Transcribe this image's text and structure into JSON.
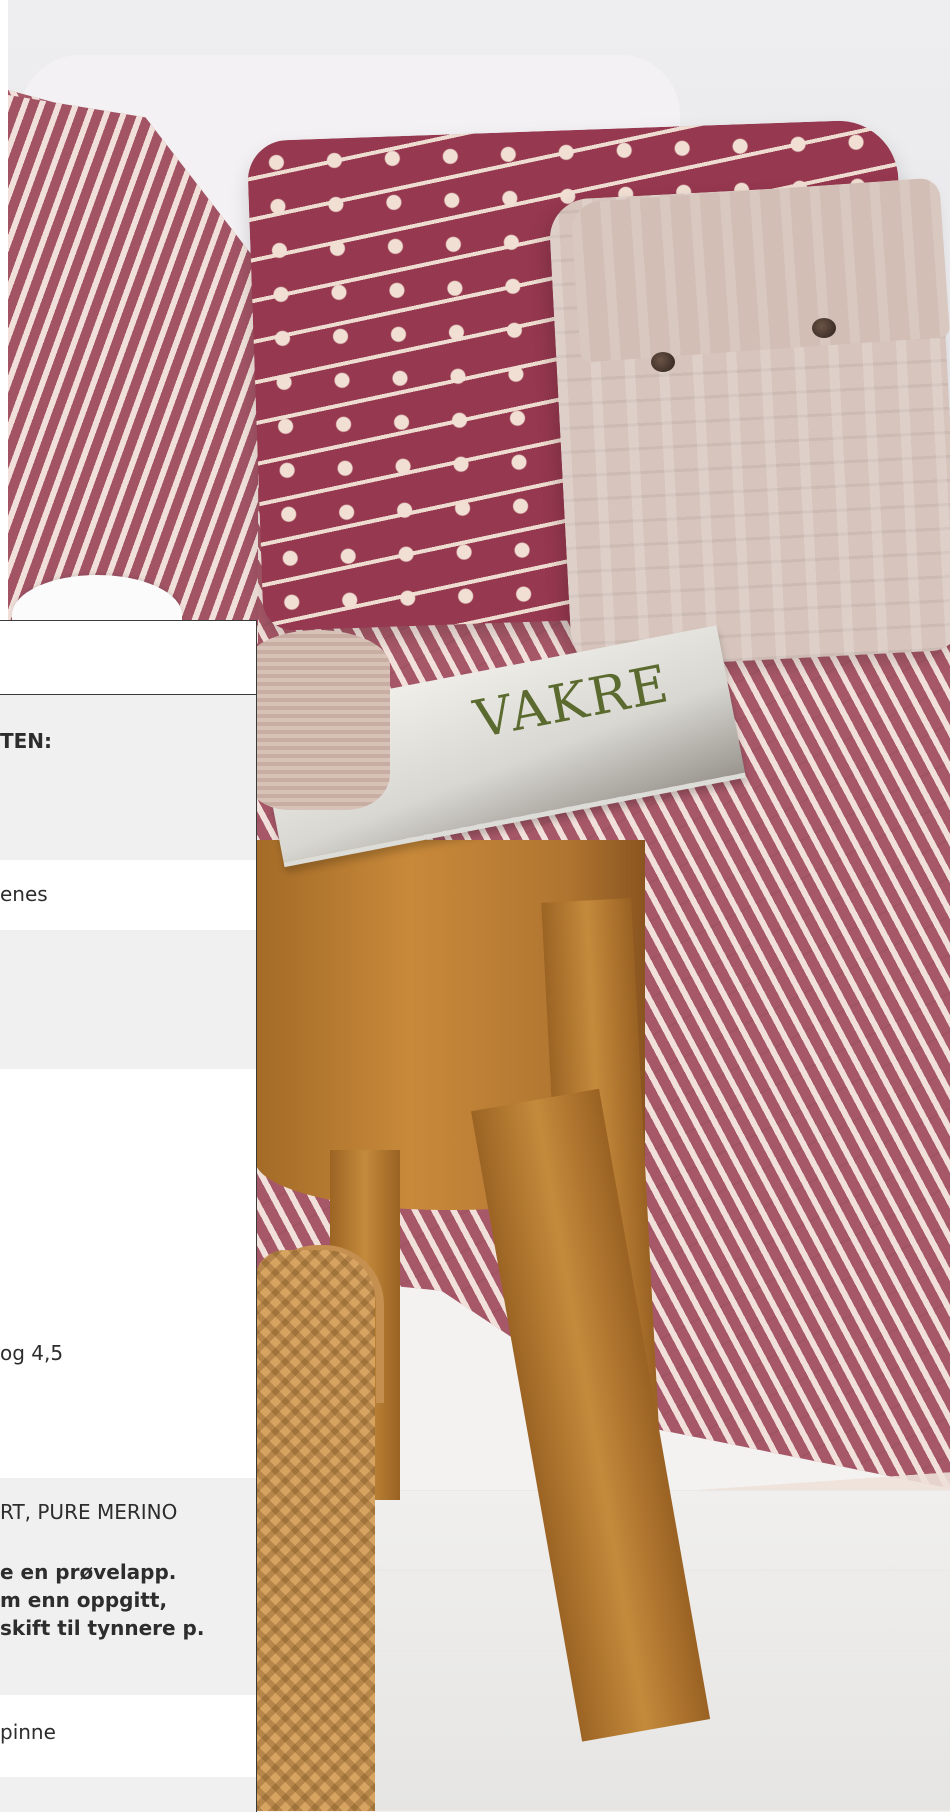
{
  "panel": {
    "rows": [
      {
        "text": "TEN:"
      },
      {
        "text": "enes"
      },
      {
        "text": "og 4,5"
      },
      {
        "text": "RT, PURE MERINO"
      },
      {
        "lines": [
          "e en prøvelapp.",
          "m enn oppgitt,",
          "skift til tynnere p."
        ]
      },
      {
        "text": "pinne"
      }
    ]
  },
  "magazine": {
    "masthead": "VAKRE"
  },
  "colors": {
    "throw_red": "#a75868",
    "pillow_red": "#96384f",
    "cable_beige": "#d7c5bd",
    "panel_grey": "#f0f0f0"
  }
}
